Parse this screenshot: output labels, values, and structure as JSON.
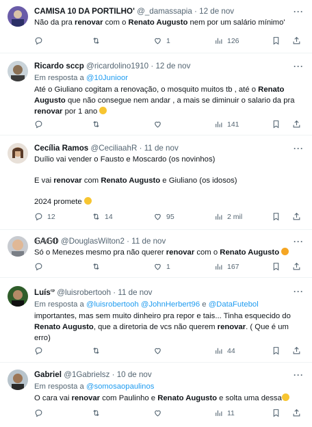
{
  "tweets": [
    {
      "name": "CAMISA 10 DA PORTILHO'",
      "handle": "@_damassapia",
      "dot": "·",
      "date": "12 de nov",
      "reply_to_prefix": "",
      "reply_to_mentions": [],
      "segments": [
        "Não da pra ",
        "renovar",
        " com o ",
        "Renato Augusto",
        " nem por um salário mínimo'"
      ],
      "replies": "",
      "retweets": "",
      "likes": "1",
      "views": "126"
    },
    {
      "name": "Ricardo sccp",
      "handle": "@ricardolino1910",
      "dot": "·",
      "date": "12 de nov",
      "reply_to_prefix": "Em resposta a",
      "reply_to_mentions": [
        "@10Junioor"
      ],
      "segments": [
        "Até o Giuliano cogitam a renovação,  o mosquito muitos tb , até o ",
        "Renato Augusto",
        " que não consegue nem andar , a mais se diminuir o salario da pra ",
        "renovar",
        " por 1 ano "
      ],
      "replies": "",
      "retweets": "",
      "likes": "",
      "views": "141"
    },
    {
      "name": "Cecília Ramos",
      "handle": "@CeciliaahR",
      "dot": "·",
      "date": "11 de nov",
      "reply_to_prefix": "",
      "reply_to_mentions": [],
      "line1": "Duílio vai vender o Fausto e Moscardo (os novinhos)",
      "segments": [
        "E vai ",
        "renovar",
        " com ",
        "Renato Augusto",
        " e Giuliano (os idosos)"
      ],
      "line3": "2024 promete ",
      "replies": "12",
      "retweets": "14",
      "likes": "95",
      "views": "2 mil"
    },
    {
      "name": "𝔾𝔸𝔾𝕆",
      "handle": "@DouglasWilton2",
      "dot": "·",
      "date": "11 de nov",
      "reply_to_prefix": "",
      "reply_to_mentions": [],
      "segments": [
        "Só o Menezes mesmo pra não querer ",
        "renovar",
        " com o ",
        "Renato Augusto",
        " "
      ],
      "replies": "",
      "retweets": "",
      "likes": "1",
      "views": "167"
    },
    {
      "name": "Luís",
      "name_suffix": "ᶜᵖ",
      "handle": "@luisrobertooh",
      "dot": "·",
      "date": "11 de nov",
      "reply_to_prefix": "Em resposta a",
      "reply_to_mentions": [
        "@luisrobertooh",
        "@JohnHerbert96",
        "e",
        "@DataFutebol"
      ],
      "segments": [
        "importantes, mas sem muito dinheiro pra repor e tais... Tinha esquecido do ",
        "Renato Augusto",
        ", que a diretoria de vcs não querem ",
        "renovar",
        ". ( Que é um erro)"
      ],
      "replies": "",
      "retweets": "",
      "likes": "",
      "views": "44"
    },
    {
      "name": "Gabriel",
      "handle": "@1Gabrielsz",
      "dot": "·",
      "date": "10 de nov",
      "reply_to_prefix": "Em resposta a",
      "reply_to_mentions": [
        "@somosaopaulinos"
      ],
      "segments": [
        "O cara vai ",
        "renovar",
        " com Paulinho e ",
        "Renato Augusto",
        " e solta uma dessa"
      ],
      "replies": "",
      "retweets": "",
      "likes": "",
      "views": "11"
    }
  ],
  "more_label": "···",
  "icon_names": [
    "reply-icon",
    "retweet-icon",
    "like-icon",
    "views-icon",
    "bookmark-icon",
    "share-icon"
  ],
  "colors": {
    "link": "#1d9bf0",
    "muted": "#536471",
    "text": "#0f1419",
    "divider": "#eff3f4"
  }
}
